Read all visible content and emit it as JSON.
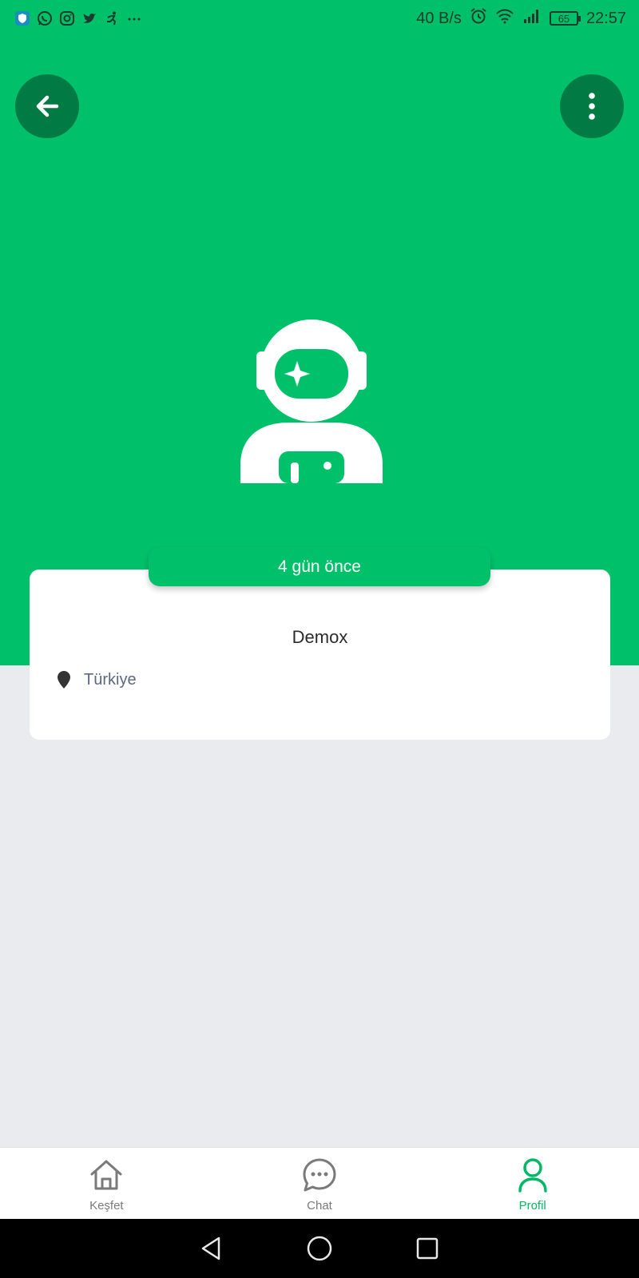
{
  "status_bar": {
    "network_speed": "40 B/s",
    "battery_level": "65",
    "time": "22:57"
  },
  "header": {
    "back_icon": "arrow-left-icon",
    "more_icon": "vertical-dots-icon"
  },
  "profile": {
    "avatar_icon": "astronaut-icon",
    "last_seen": "4 gün önce",
    "name": "Demox",
    "location_icon": "location-pin-icon",
    "location": "Türkiye"
  },
  "bottom_nav": {
    "items": [
      {
        "label": "Keşfet",
        "icon": "home-icon",
        "active": false
      },
      {
        "label": "Chat",
        "icon": "chat-bubble-icon",
        "active": false
      },
      {
        "label": "Profil",
        "icon": "user-icon",
        "active": true
      }
    ]
  },
  "colors": {
    "brand_green": "#00c16a",
    "dark_green": "#017a44",
    "inactive_gray": "#7a7a7a"
  }
}
